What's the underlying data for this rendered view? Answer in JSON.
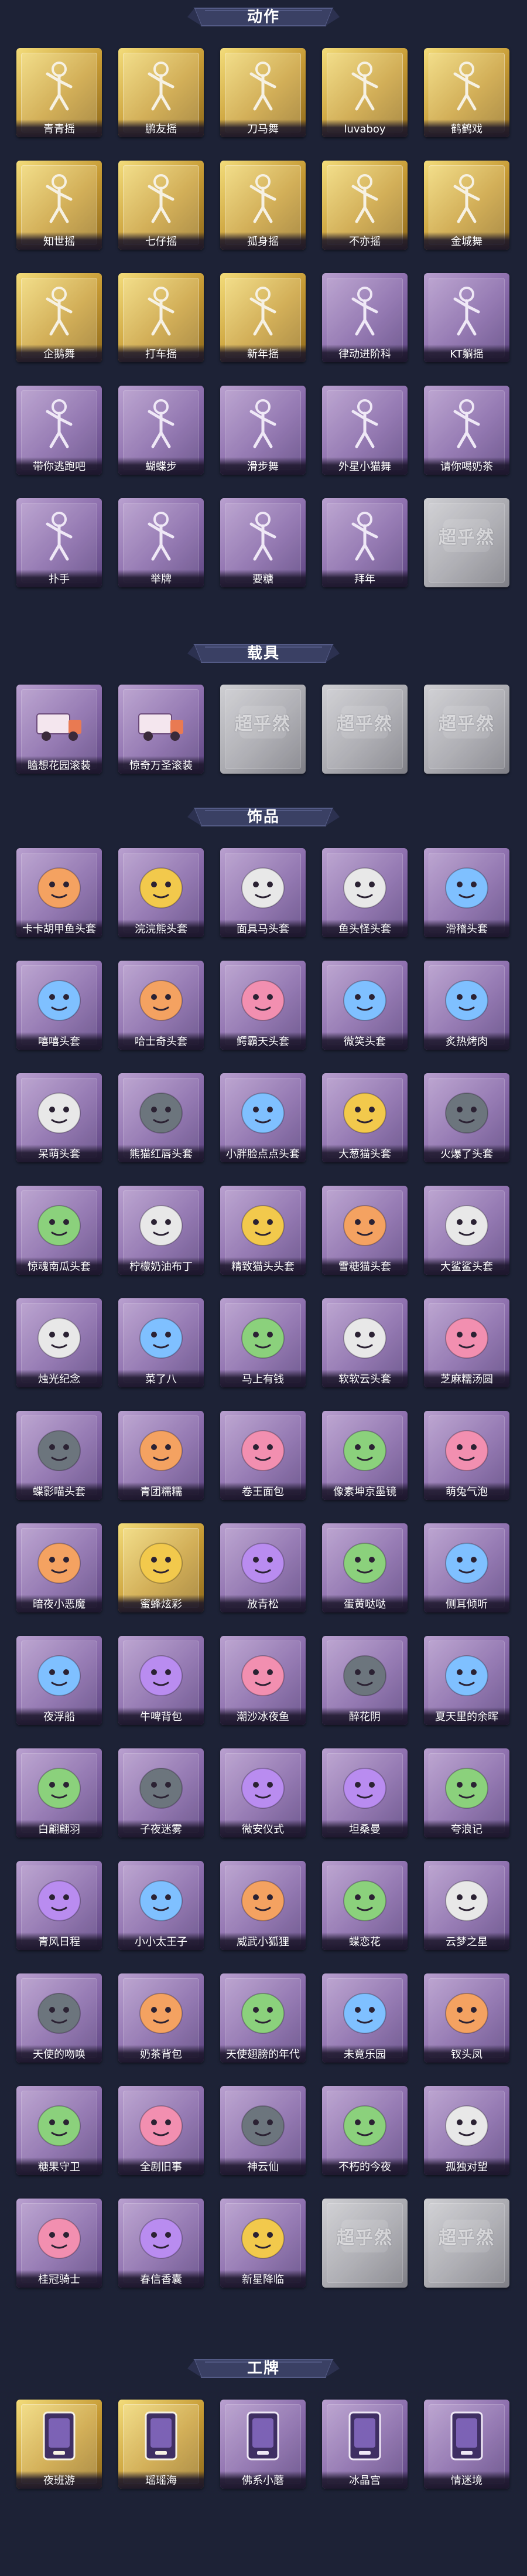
{
  "colors": {
    "background": "#1d2236",
    "banner": "#3a4064",
    "gold": "#d7b04b",
    "purple": "#8a6cab",
    "gray": "#a7a7ad"
  },
  "sections": [
    {
      "title": "动作",
      "items": [
        {
          "label": "青青摇",
          "rarity": "gold",
          "icon": "pose-figure-icon"
        },
        {
          "label": "鹏友摇",
          "rarity": "gold",
          "icon": "pose-figure-icon"
        },
        {
          "label": "刀马舞",
          "rarity": "gold",
          "icon": "pose-figure-icon"
        },
        {
          "label": "luvaboy",
          "rarity": "gold",
          "icon": "pose-figure-icon"
        },
        {
          "label": "鹤鹤戏",
          "rarity": "gold",
          "icon": "pose-figure-icon"
        },
        {
          "label": "知世摇",
          "rarity": "gold",
          "icon": "pose-figure-icon"
        },
        {
          "label": "七仔摇",
          "rarity": "gold",
          "icon": "pose-figure-icon"
        },
        {
          "label": "孤身摇",
          "rarity": "gold",
          "icon": "pose-figure-icon"
        },
        {
          "label": "不亦摇",
          "rarity": "gold",
          "icon": "pose-figure-icon"
        },
        {
          "label": "金城舞",
          "rarity": "gold",
          "icon": "pose-figure-icon"
        },
        {
          "label": "企鹅舞",
          "rarity": "gold",
          "icon": "pose-figure-icon"
        },
        {
          "label": "打车摇",
          "rarity": "gold",
          "icon": "pose-figure-icon"
        },
        {
          "label": "新年摇",
          "rarity": "gold",
          "icon": "pose-figure-icon"
        },
        {
          "label": "律动进阶科",
          "rarity": "purple",
          "icon": "pose-figure-icon"
        },
        {
          "label": "KT躺摇",
          "rarity": "purple",
          "icon": "pose-figure-icon"
        },
        {
          "label": "带你逃跑吧",
          "rarity": "purple",
          "icon": "pose-figure-icon"
        },
        {
          "label": "蝴蝶步",
          "rarity": "purple",
          "icon": "pose-figure-icon"
        },
        {
          "label": "滑步舞",
          "rarity": "purple",
          "icon": "pose-figure-icon"
        },
        {
          "label": "外星小猫舞",
          "rarity": "purple",
          "icon": "pose-figure-icon"
        },
        {
          "label": "请你喝奶茶",
          "rarity": "purple",
          "icon": "pose-figure-icon"
        },
        {
          "label": "扑手",
          "rarity": "purple",
          "icon": "pose-figure-icon"
        },
        {
          "label": "举牌",
          "rarity": "purple",
          "icon": "pose-figure-icon"
        },
        {
          "label": "要糖",
          "rarity": "purple",
          "icon": "pose-figure-icon"
        },
        {
          "label": "拜年",
          "rarity": "purple",
          "icon": "pose-figure-icon"
        },
        {
          "label": "",
          "rarity": "gray",
          "icon": "locked-placeholder-icon",
          "locked_text": "超乎然"
        }
      ]
    },
    {
      "title": "载具",
      "items": [
        {
          "label": "瞌想花园滚装",
          "rarity": "purple",
          "icon": "ice-cream-truck-icon"
        },
        {
          "label": "惊奇万圣滚装",
          "rarity": "purple",
          "icon": "halloween-truck-icon"
        },
        {
          "label": "",
          "rarity": "gray",
          "icon": "locked-placeholder-icon",
          "locked_text": "超乎然"
        },
        {
          "label": "",
          "rarity": "gray",
          "icon": "locked-placeholder-icon",
          "locked_text": "超乎然"
        },
        {
          "label": "",
          "rarity": "gray",
          "icon": "locked-placeholder-icon",
          "locked_text": "超乎然"
        }
      ]
    },
    {
      "title": "饰品",
      "items": [
        {
          "label": "卡卡胡甲鱼头套",
          "rarity": "purple",
          "icon": "turtle-head-icon"
        },
        {
          "label": "浣浣熊头套",
          "rarity": "purple",
          "icon": "raccoon-head-icon"
        },
        {
          "label": "面具马头套",
          "rarity": "purple",
          "icon": "horse-head-icon"
        },
        {
          "label": "鱼头怪头套",
          "rarity": "purple",
          "icon": "fish-monster-head-icon"
        },
        {
          "label": "滑稽头套",
          "rarity": "purple",
          "icon": "smirk-emoji-head-icon"
        },
        {
          "label": "嘻嘻头套",
          "rarity": "purple",
          "icon": "grin-emoji-head-icon"
        },
        {
          "label": "哈士奇头套",
          "rarity": "purple",
          "icon": "husky-head-icon"
        },
        {
          "label": "鳄霸天头套",
          "rarity": "purple",
          "icon": "crocodile-head-icon"
        },
        {
          "label": "微笑头套",
          "rarity": "purple",
          "icon": "smile-emoji-head-icon"
        },
        {
          "label": "炙热烤肉",
          "rarity": "purple",
          "icon": "bbq-head-icon"
        },
        {
          "label": "呆萌头套",
          "rarity": "purple",
          "icon": "dizzy-emoji-head-icon"
        },
        {
          "label": "熊猫红唇头套",
          "rarity": "purple",
          "icon": "duck-glasses-head-icon"
        },
        {
          "label": "小胖脸点点头套",
          "rarity": "purple",
          "icon": "chubby-face-head-icon"
        },
        {
          "label": "大葱猫头套",
          "rarity": "purple",
          "icon": "scallion-head-icon"
        },
        {
          "label": "火爆了头套",
          "rarity": "purple",
          "icon": "fire-head-icon"
        },
        {
          "label": "惊魂南瓜头套",
          "rarity": "purple",
          "icon": "pumpkin-head-icon"
        },
        {
          "label": "柠檬奶油布丁",
          "rarity": "purple",
          "icon": "pudding-head-icon"
        },
        {
          "label": "精致猫头头套",
          "rarity": "purple",
          "icon": "pink-cat-head-icon"
        },
        {
          "label": "雪糖猫头套",
          "rarity": "purple",
          "icon": "snow-cat-head-icon"
        },
        {
          "label": "大鲨鲨头套",
          "rarity": "purple",
          "icon": "shark-head-icon"
        },
        {
          "label": "烛光纪念",
          "rarity": "purple",
          "icon": "candle-head-icon"
        },
        {
          "label": "菜了八",
          "rarity": "purple",
          "icon": "radish-head-icon"
        },
        {
          "label": "马上有钱",
          "rarity": "purple",
          "icon": "money-head-icon"
        },
        {
          "label": "软软云头套",
          "rarity": "purple",
          "icon": "cloud-head-icon"
        },
        {
          "label": "芝麻糯汤圆",
          "rarity": "purple",
          "icon": "dumpling-head-icon"
        },
        {
          "label": "蝶影喵头套",
          "rarity": "purple",
          "icon": "cat-head-icon"
        },
        {
          "label": "青团糯糯",
          "rarity": "purple",
          "icon": "green-dumpling-head-icon"
        },
        {
          "label": "卷王面包",
          "rarity": "purple",
          "icon": "bread-roll-head-icon"
        },
        {
          "label": "像素坤京墨镜",
          "rarity": "purple",
          "icon": "pixel-sunglasses-icon"
        },
        {
          "label": "萌兔气泡",
          "rarity": "purple",
          "icon": "bunny-bubble-icon"
        },
        {
          "label": "暗夜小恶魔",
          "rarity": "purple",
          "icon": "little-devil-icon"
        },
        {
          "label": "蜜蜂炫彩",
          "rarity": "gold",
          "icon": "bee-doll-icon"
        },
        {
          "label": "放青松",
          "rarity": "purple",
          "icon": "bonsai-icon"
        },
        {
          "label": "蛋黄哒哒",
          "rarity": "purple",
          "icon": "egg-yolk-icon"
        },
        {
          "label": "侧耳倾听",
          "rarity": "purple",
          "icon": "flower-ear-icon"
        },
        {
          "label": "夜浮船",
          "rarity": "purple",
          "icon": "ice-crystal-icon"
        },
        {
          "label": "牛啤背包",
          "rarity": "purple",
          "icon": "cow-backpack-icon"
        },
        {
          "label": "潮沙冰夜鱼",
          "rarity": "purple",
          "icon": "blue-cat-icon"
        },
        {
          "label": "醉花阴",
          "rarity": "purple",
          "icon": "blue-ornament-icon"
        },
        {
          "label": "夏天里的余晖",
          "rarity": "purple",
          "icon": "girl-doll-icon"
        },
        {
          "label": "白翩翩羽",
          "rarity": "purple",
          "icon": "white-spirit-icon"
        },
        {
          "label": "子夜迷雾",
          "rarity": "purple",
          "icon": "black-wing-doll-icon"
        },
        {
          "label": "微安仪式",
          "rarity": "purple",
          "icon": "orange-doll-icon"
        },
        {
          "label": "坦桑曼",
          "rarity": "purple",
          "icon": "pink-doll-icon"
        },
        {
          "label": "夸浪记",
          "rarity": "purple",
          "icon": "hat-doll-icon"
        },
        {
          "label": "青风日程",
          "rarity": "purple",
          "icon": "red-hair-doll-icon"
        },
        {
          "label": "小小太王子",
          "rarity": "purple",
          "icon": "blue-prince-icon"
        },
        {
          "label": "威武小狐狸",
          "rarity": "purple",
          "icon": "fox-doll-icon"
        },
        {
          "label": "蝶恋花",
          "rarity": "purple",
          "icon": "butterfly-charm-icon"
        },
        {
          "label": "云梦之星",
          "rarity": "purple",
          "icon": "unicorn-icon"
        },
        {
          "label": "天使的吻唤",
          "rarity": "purple",
          "icon": "angel-doll-icon"
        },
        {
          "label": "奶茶背包",
          "rarity": "purple",
          "icon": "milk-tea-bag-icon"
        },
        {
          "label": "天使翅膀的年代",
          "rarity": "purple",
          "icon": "white-angel-icon"
        },
        {
          "label": "未竟乐园",
          "rarity": "purple",
          "icon": "purple-fairy-icon"
        },
        {
          "label": "钗头凤",
          "rarity": "purple",
          "icon": "phoenix-doll-icon"
        },
        {
          "label": "糖果守卫",
          "rarity": "purple",
          "icon": "candy-guard-icon"
        },
        {
          "label": "全剧旧事",
          "rarity": "purple",
          "icon": "gentleman-doll-icon"
        },
        {
          "label": "神云仙",
          "rarity": "purple",
          "icon": "cloud-charm-icon"
        },
        {
          "label": "不朽的今夜",
          "rarity": "purple",
          "icon": "pink-bear-charm-icon"
        },
        {
          "label": "孤独对望",
          "rarity": "purple",
          "icon": "crystal-charm-icon"
        },
        {
          "label": "桂冠骑士",
          "rarity": "purple",
          "icon": "knight-doll-icon"
        },
        {
          "label": "春信香囊",
          "rarity": "purple",
          "icon": "sachet-icon"
        },
        {
          "label": "新星降临",
          "rarity": "purple",
          "icon": "star-doll-icon"
        },
        {
          "label": "",
          "rarity": "gray",
          "icon": "locked-placeholder-icon",
          "locked_text": "超乎然"
        },
        {
          "label": "",
          "rarity": "gray",
          "icon": "locked-placeholder-icon",
          "locked_text": "超乎然"
        }
      ]
    },
    {
      "title": "工牌",
      "items": [
        {
          "label": "夜班游",
          "rarity": "gold",
          "icon": "badge-card-icon"
        },
        {
          "label": "瑶瑶海",
          "rarity": "gold",
          "icon": "badge-card-icon"
        },
        {
          "label": "佛系小蘑",
          "rarity": "purple",
          "icon": "badge-card-icon"
        },
        {
          "label": "冰晶宫",
          "rarity": "purple",
          "icon": "badge-card-icon"
        },
        {
          "label": "情迷境",
          "rarity": "purple",
          "icon": "badge-card-icon"
        }
      ]
    }
  ]
}
